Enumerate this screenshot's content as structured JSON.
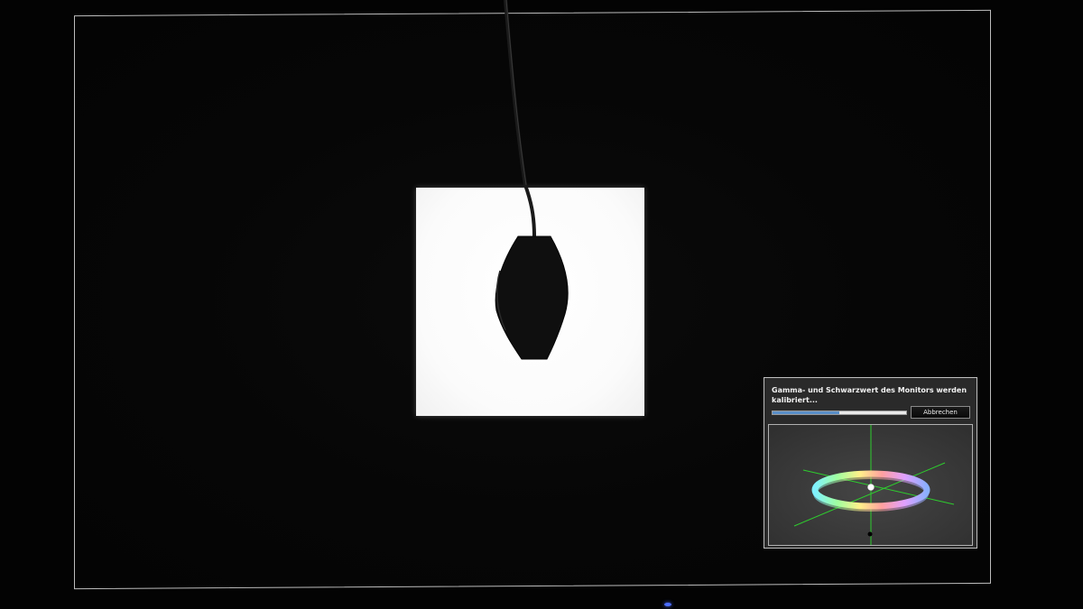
{
  "scene": {
    "background_color": "#030303",
    "frame_color": "#bdbdbd",
    "patch_color": "#ffffff",
    "sensor_color": "#0f0f0f",
    "indicator_color": "#4a6cff"
  },
  "dialog": {
    "title": "Gamma- und Schwarzwert des Monitors werden kalibriert...",
    "progress_fraction": 0.5,
    "progress_color": "#5a8fc8",
    "cancel_label": "Abbrechen",
    "axis_color": "#2ecc2e",
    "icons": {
      "color_ring": "hue-ring-icon",
      "axes": "3d-axes-icon"
    }
  }
}
